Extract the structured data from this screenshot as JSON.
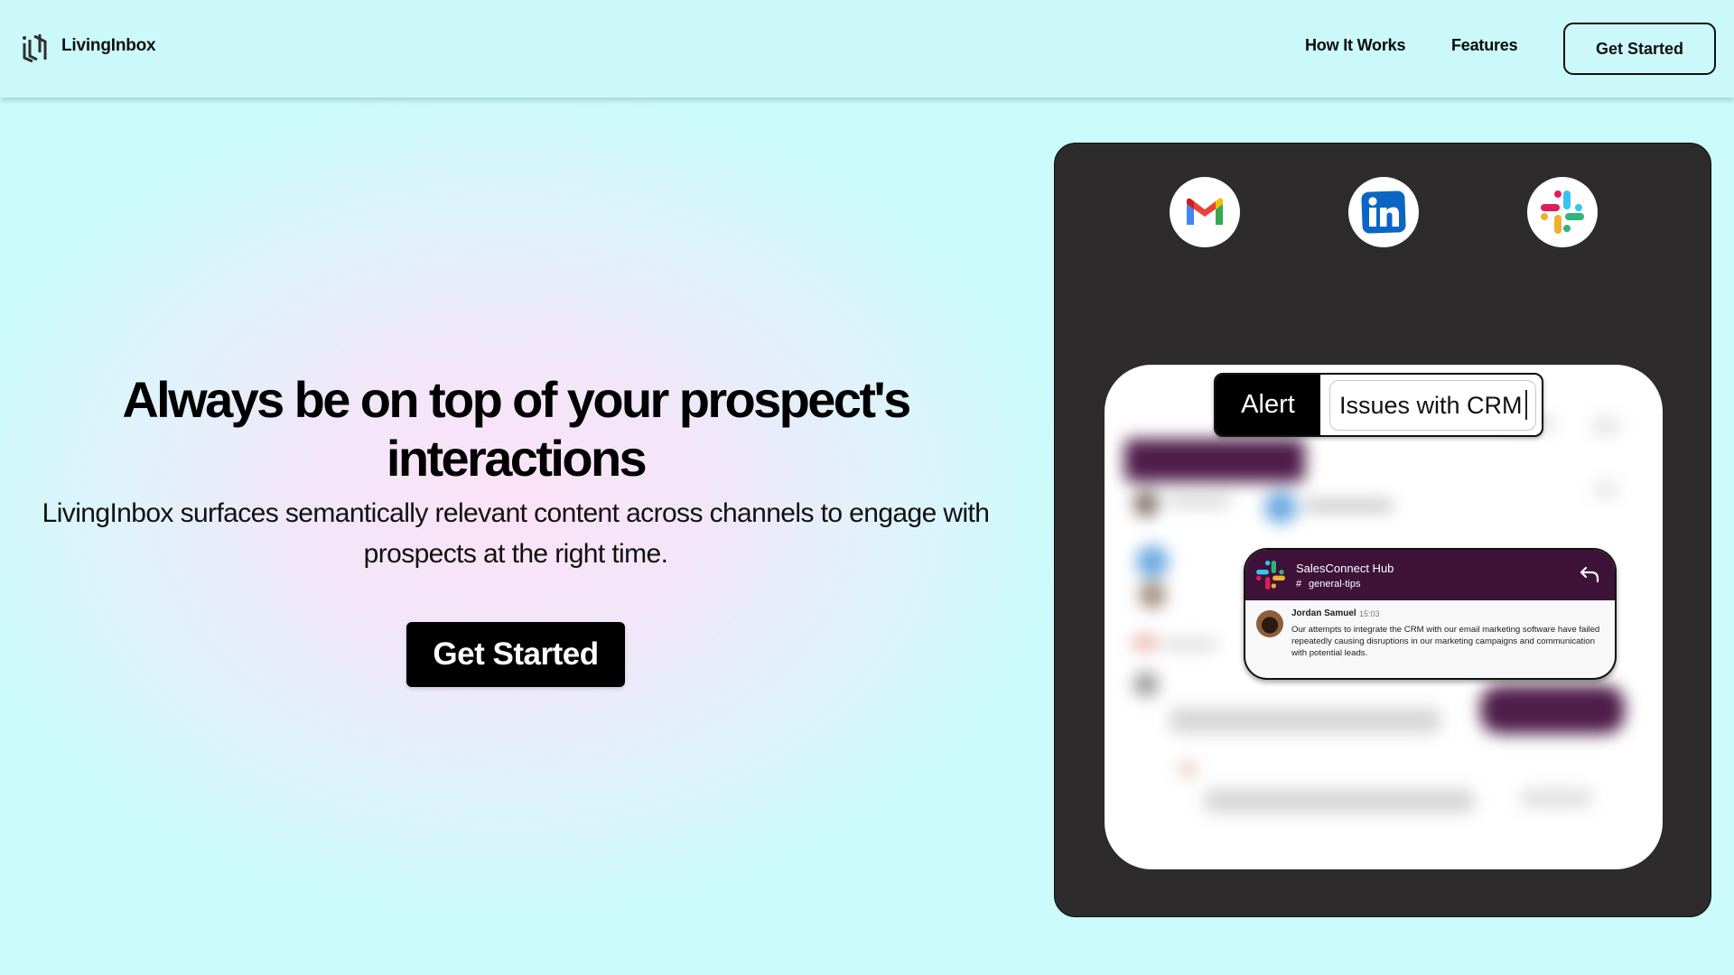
{
  "header": {
    "brand": "LivingInbox",
    "nav": [
      {
        "label": "How It Works"
      },
      {
        "label": "Features"
      }
    ],
    "cta_label": "Get Started"
  },
  "hero": {
    "title": "Always be on top of your prospect's interactions",
    "subtitle": "LivingInbox surfaces semantically relevant content across channels to engage with prospects at the right time.",
    "cta_label": "Get Started"
  },
  "demo": {
    "channels": [
      {
        "name": "Gmail",
        "icon": "gmail-icon"
      },
      {
        "name": "LinkedIn",
        "icon": "linkedin-icon"
      },
      {
        "name": "Slack",
        "icon": "slack-icon"
      }
    ],
    "alert": {
      "label": "Alert",
      "value": "Issues with CRM"
    },
    "slack_message": {
      "workspace": "SalesConnect Hub",
      "channel_prefix": "#",
      "channel": "general-tips",
      "author": "Jordan Samuel",
      "time": "15:03",
      "text": "Our attempts to integrate the CRM with our email marketing software have failed repeatedly causing disruptions in our marketing campaigns and communication with potential leads."
    }
  },
  "colors": {
    "page_bg": "#cbfbfa",
    "panel_bg": "#2d2b2c",
    "slack_purple": "#3e1239",
    "linkedin_blue": "#0a66c2"
  }
}
